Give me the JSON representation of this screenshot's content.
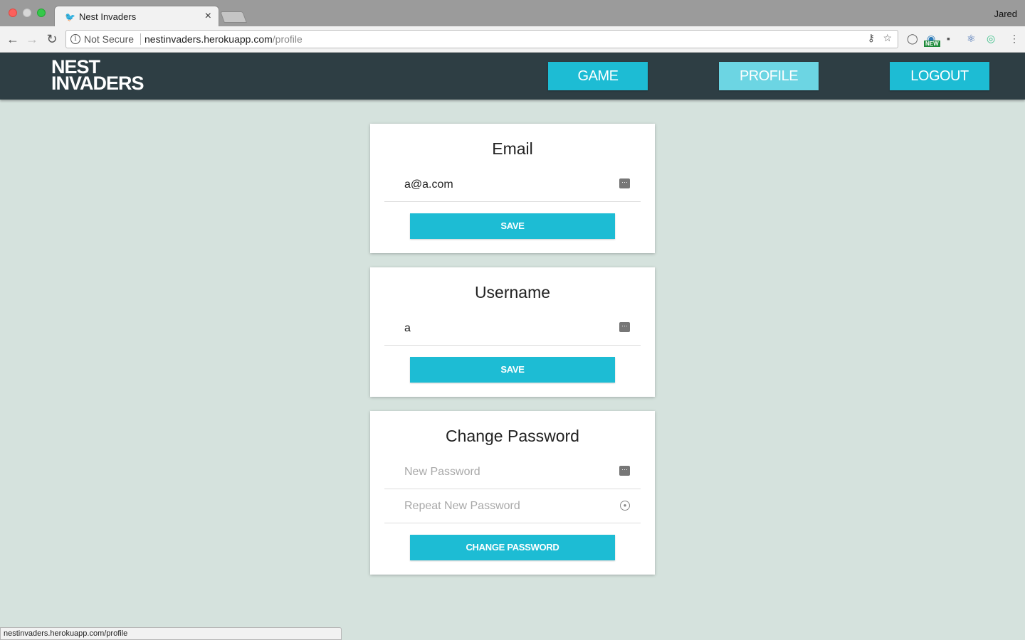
{
  "browser": {
    "tab_title": "Nest Invaders",
    "tab_close": "×",
    "profile_name": "Jared",
    "security_label": "Not Secure",
    "url_host": "nestinvaders.herokuapp.com",
    "url_path": "/profile",
    "status_url": "nestinvaders.herokuapp.com/profile",
    "ext_new_badge": "NEW"
  },
  "header": {
    "logo_line1": "NEST",
    "logo_line2": "INVADERS",
    "nav": {
      "game": "GAME",
      "profile": "PROFILE",
      "logout": "LOGOUT"
    }
  },
  "email_card": {
    "title": "Email",
    "value": "a@a.com",
    "save_label": "SAVE"
  },
  "username_card": {
    "title": "Username",
    "value": "a",
    "save_label": "SAVE"
  },
  "password_card": {
    "title": "Change Password",
    "new_placeholder": "New Password",
    "repeat_placeholder": "Repeat New Password",
    "button_label": "CHANGE PASSWORD"
  },
  "colors": {
    "header_bg": "#2e3e44",
    "accent": "#1dbcd4",
    "accent_active": "#6cd5e3",
    "page_bg": "#d5e2dd"
  }
}
